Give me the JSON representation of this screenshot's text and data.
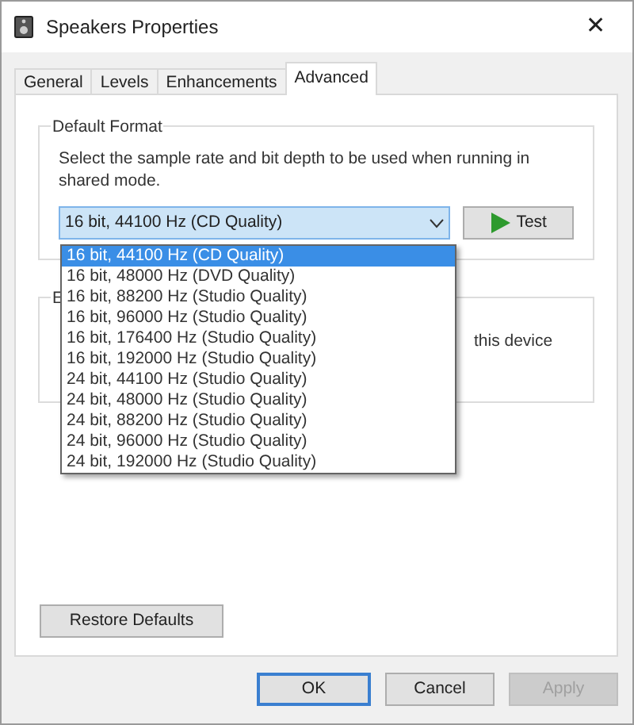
{
  "window": {
    "title": "Speakers Properties",
    "close": "✕"
  },
  "tabs": [
    {
      "label": "General",
      "selected": false
    },
    {
      "label": "Levels",
      "selected": false
    },
    {
      "label": "Enhancements",
      "selected": false
    },
    {
      "label": "Advanced",
      "selected": true
    }
  ],
  "default_format": {
    "title": "Default Format",
    "description": "Select the sample rate and bit depth to be used when running in shared mode.",
    "value": "16 bit, 44100 Hz (CD Quality)",
    "test_button": "Test",
    "options": [
      {
        "label": "16 bit, 44100 Hz (CD Quality)",
        "selected": true
      },
      {
        "label": "16 bit, 48000 Hz (DVD Quality)",
        "selected": false
      },
      {
        "label": "16 bit, 88200 Hz (Studio Quality)",
        "selected": false
      },
      {
        "label": "16 bit, 96000 Hz (Studio Quality)",
        "selected": false
      },
      {
        "label": "16 bit, 176400 Hz (Studio Quality)",
        "selected": false
      },
      {
        "label": "16 bit, 192000 Hz (Studio Quality)",
        "selected": false
      },
      {
        "label": "24 bit, 44100 Hz (Studio Quality)",
        "selected": false
      },
      {
        "label": "24 bit, 48000 Hz (Studio Quality)",
        "selected": false
      },
      {
        "label": "24 bit, 88200 Hz (Studio Quality)",
        "selected": false
      },
      {
        "label": "24 bit, 96000 Hz (Studio Quality)",
        "selected": false
      },
      {
        "label": "24 bit, 192000 Hz (Studio Quality)",
        "selected": false
      }
    ]
  },
  "second_group": {
    "title": "E",
    "text": "this device"
  },
  "restore_button": "Restore Defaults",
  "buttons": [
    {
      "label": "OK",
      "kind": "default",
      "disabled": false
    },
    {
      "label": "Cancel",
      "kind": "normal",
      "disabled": false
    },
    {
      "label": "Apply",
      "kind": "normal",
      "disabled": true
    }
  ]
}
